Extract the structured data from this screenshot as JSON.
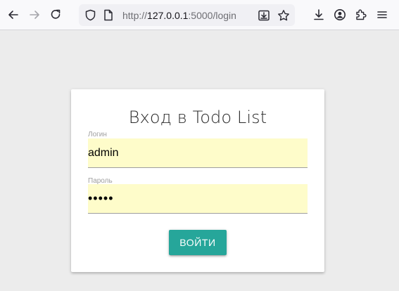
{
  "browser": {
    "url_host": "127.0.0.1",
    "url_scheme": "http://",
    "url_port_path": ":5000/login",
    "icons": {
      "back": "arrow-left-icon",
      "forward": "arrow-right-icon",
      "reload": "reload-icon",
      "shield": "shield-icon",
      "page": "page-icon",
      "save_page": "save-to-pocket-icon",
      "bookmark": "star-icon",
      "downloads": "download-icon",
      "account": "account-icon",
      "extensions": "puzzle-icon",
      "menu": "hamburger-menu-icon"
    }
  },
  "login": {
    "title": "Вход в Todo List",
    "username_label": "Логин",
    "username_value": "admin",
    "password_label": "Пароль",
    "password_value": "admin",
    "submit_label": "ВОЙТИ"
  },
  "colors": {
    "page_bg": "#ececec",
    "accent": "#26a69a",
    "autofill_bg": "#fefcca"
  }
}
